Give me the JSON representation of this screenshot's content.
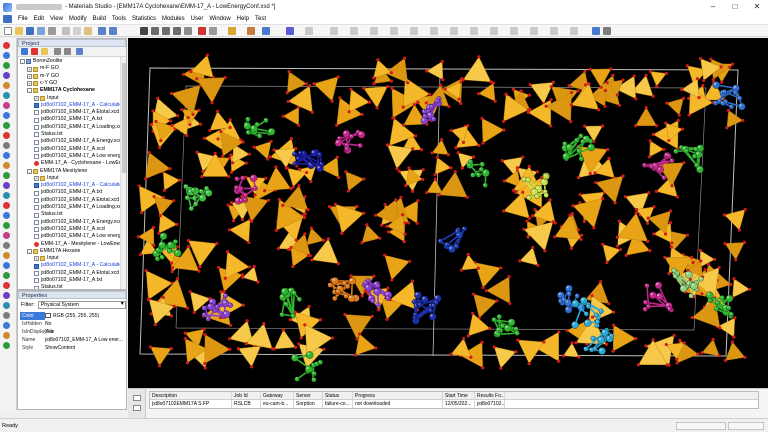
{
  "window": {
    "title": "- Materials Studio - [EMM17A Cyclohexane\\EMM-17_A - LowEnergyConf.xsd *]",
    "controls": [
      "–",
      "□",
      "✕"
    ]
  },
  "menu": [
    "File",
    "Edit",
    "View",
    "Modify",
    "Build",
    "Tools",
    "Statistics",
    "Modules",
    "User",
    "Window",
    "Help",
    "Test"
  ],
  "project_panel": {
    "header": "Project",
    "tree": [
      {
        "label": "BoronZeolite",
        "indent": 0,
        "icon": "root",
        "toggle": "-"
      },
      {
        "label": "m-F GO",
        "indent": 1,
        "icon": "folder",
        "toggle": "+"
      },
      {
        "label": "m-Y GO",
        "indent": 1,
        "icon": "folder",
        "toggle": "+"
      },
      {
        "label": "c-Y GO",
        "indent": 1,
        "icon": "folder",
        "toggle": "+"
      },
      {
        "label": "EMM17A Cyclohexane",
        "indent": 1,
        "icon": "folder",
        "toggle": "-",
        "bold": true
      },
      {
        "label": "Input",
        "indent": 2,
        "icon": "folder",
        "toggle": "+"
      },
      {
        "label": "jst8o07102_EMM-17_A - Calculation",
        "indent": 2,
        "icon": "blue",
        "blue": true
      },
      {
        "label": "jst8o07102_EMM-17_A Etotal.xcd",
        "indent": 2,
        "icon": "doc"
      },
      {
        "label": "jst8o07102_EMM-17_A.txt",
        "indent": 2,
        "icon": "doc"
      },
      {
        "label": "jst8o07102_EMM-17_A Loading.xcd",
        "indent": 2,
        "icon": "doc"
      },
      {
        "label": "Status.txt",
        "indent": 2,
        "icon": "doc"
      },
      {
        "label": "jst8o07102_EMM-17_A Energy.xcd",
        "indent": 2,
        "icon": "doc"
      },
      {
        "label": "jst8o07102_EMM-17_A.xcd",
        "indent": 2,
        "icon": "doc"
      },
      {
        "label": "jst8o07102_EMM-17_A Low energy.x",
        "indent": 2,
        "icon": "doc"
      },
      {
        "label": "EMM-17_A - Cyclohexane - LowEner",
        "indent": 2,
        "icon": "mol"
      },
      {
        "label": "EMM17A Mesitylene",
        "indent": 1,
        "icon": "folder",
        "toggle": "-"
      },
      {
        "label": "Input",
        "indent": 2,
        "icon": "folder",
        "toggle": "+"
      },
      {
        "label": "jst8o07102_EMM-17_A - Calculation",
        "indent": 2,
        "icon": "blue",
        "blue": true
      },
      {
        "label": "jst8o07102_EMM-17_A.txt",
        "indent": 2,
        "icon": "doc"
      },
      {
        "label": "jst8o07102_EMM-17_A Etotal.xcd",
        "indent": 2,
        "icon": "doc"
      },
      {
        "label": "jst8o07102_EMM-17_A Loading.xcd",
        "indent": 2,
        "icon": "doc"
      },
      {
        "label": "Status.txt",
        "indent": 2,
        "icon": "doc"
      },
      {
        "label": "jst8o07102_EMM-17_A Energy.xcd",
        "indent": 2,
        "icon": "doc"
      },
      {
        "label": "jst8o07102_EMM-17_A.xcd",
        "indent": 2,
        "icon": "doc"
      },
      {
        "label": "jst8o07102_EMM-17_A Low energy.x",
        "indent": 2,
        "icon": "doc"
      },
      {
        "label": "EMM-17_A - Mesitylene - LowEnerg",
        "indent": 2,
        "icon": "mol"
      },
      {
        "label": "EMM17A Hexane",
        "indent": 1,
        "icon": "folder",
        "toggle": "-"
      },
      {
        "label": "Input",
        "indent": 2,
        "icon": "folder",
        "toggle": "+"
      },
      {
        "label": "jst8o07102_EMM-17_A - Calculation",
        "indent": 2,
        "icon": "blue",
        "blue": true
      },
      {
        "label": "jst8o07102_EMM-17_A Etotal.xcd",
        "indent": 2,
        "icon": "doc"
      },
      {
        "label": "jst8o07102_EMM-17_A.txt",
        "indent": 2,
        "icon": "doc"
      },
      {
        "label": "Status.txt",
        "indent": 2,
        "icon": "doc"
      }
    ]
  },
  "properties_panel": {
    "header": "Properties",
    "filter_label": "Filter:",
    "filter_value": "Physical System",
    "rows": [
      {
        "name": "Color",
        "value": "RGB (255, 255, 255)",
        "selected": true,
        "swatch": true
      },
      {
        "name": "IsHidden",
        "value": "No"
      },
      {
        "name": "IsInDisplayFile",
        "value": "Yes"
      },
      {
        "name": "Name",
        "value": "jst8o07102_EMM-17_A Low ener..."
      },
      {
        "name": "Style",
        "value": "ShowContent"
      }
    ]
  },
  "jobs": {
    "headers": [
      "Description",
      "Job Id",
      "Gateway",
      "Server",
      "Status",
      "Progress",
      "Start Time",
      "Results Fo..."
    ],
    "rows": [
      [
        "jst8o07102EMM17A S.FP",
        "RSLCB",
        "eu-cam-b...",
        "Sorption",
        "failure-co...",
        "not downloaded",
        "12/05/202...",
        "jst8o07102..."
      ]
    ]
  },
  "status_bar": {
    "text": "Ready"
  },
  "colors": {
    "viewport_bg": "#000000",
    "framework": "#f2b01e",
    "oxygen": "#d11b1b",
    "selection": "#3b78d8"
  }
}
